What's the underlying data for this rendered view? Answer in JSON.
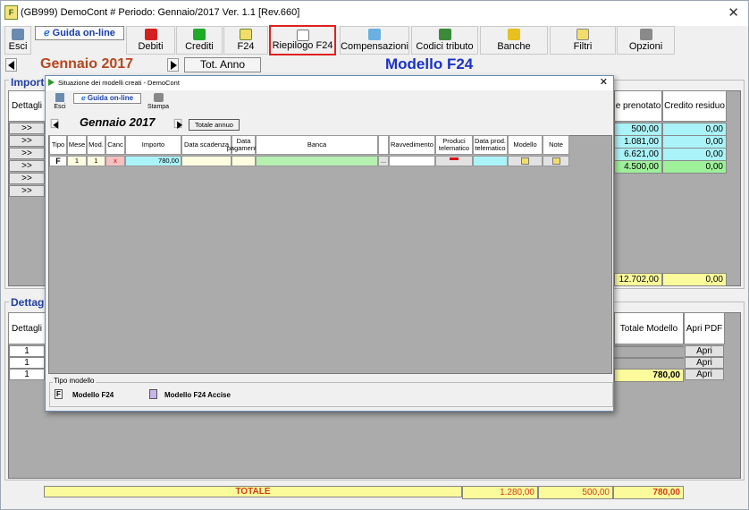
{
  "window": {
    "title": "(GB999) DemoCont  # Periodo: Gennaio/2017 Ver. 1.1 [Rev.660]",
    "close": "✕"
  },
  "toolbar": {
    "esci": "Esci",
    "guida": "Guida on-line",
    "debiti": "Debiti",
    "crediti": "Crediti",
    "f24": "F24",
    "riepilogo": "Riepilogo F24",
    "compensazioni": "Compensazioni",
    "codici": "Codici tributo",
    "banche": "Banche",
    "filtri": "Filtri",
    "opzioni": "Opzioni"
  },
  "period": {
    "month": "Gennaio 2017",
    "tot_anno": "Tot. Anno",
    "title": "Modello F24"
  },
  "importi": {
    "section": "Importi",
    "dettagli": "Dettagli",
    "arrow": ">>",
    "col_prenotato": "e prenotato",
    "col_credito": "Credito residuo",
    "rows": [
      {
        "p": "500,00",
        "c": "0,00"
      },
      {
        "p": "1.081,00",
        "c": "0,00"
      },
      {
        "p": "6.621,00",
        "c": "0,00"
      },
      {
        "p": "4.500,00",
        "c": "0,00"
      }
    ],
    "total_prenotato": "12.702,00",
    "total_credito": "0,00"
  },
  "dettagli": {
    "section": "Dettagl",
    "col_dettagli": "Dettagli",
    "col_totale": "Totale Modello",
    "col_apri": "Apri PDF",
    "row_num": "1",
    "apri": "Apri",
    "value": "780,00"
  },
  "totals": {
    "label": "TOTALE",
    "v1": "1.280,00",
    "v2": "500,00",
    "v3": "780,00"
  },
  "dialog": {
    "title": "Situazione dei modelli creati - DemoCont",
    "close": "✕",
    "esci": "Esci",
    "guida": "Guida on-line",
    "stampa": "Stampa",
    "month": "Gennaio 2017",
    "totale_annuo": "Totale annuo",
    "headers": [
      "Tipo",
      "Mese",
      "Mod.",
      "Canc",
      "Importo",
      "Data scadenza",
      "Data pagamento",
      "Banca",
      "",
      "Ravvedimento",
      "Produci telematico",
      "Data prod. telematico",
      "Modello",
      "Note"
    ],
    "row": {
      "tipo": "F",
      "mese": "1",
      "mod": "1",
      "canc": "x",
      "importo": "780,00",
      "dots": "..."
    },
    "tipo_modello": "Tipo modello",
    "legend_f24": "Modello F24",
    "legend_accise": "Modello F24 Accise"
  }
}
